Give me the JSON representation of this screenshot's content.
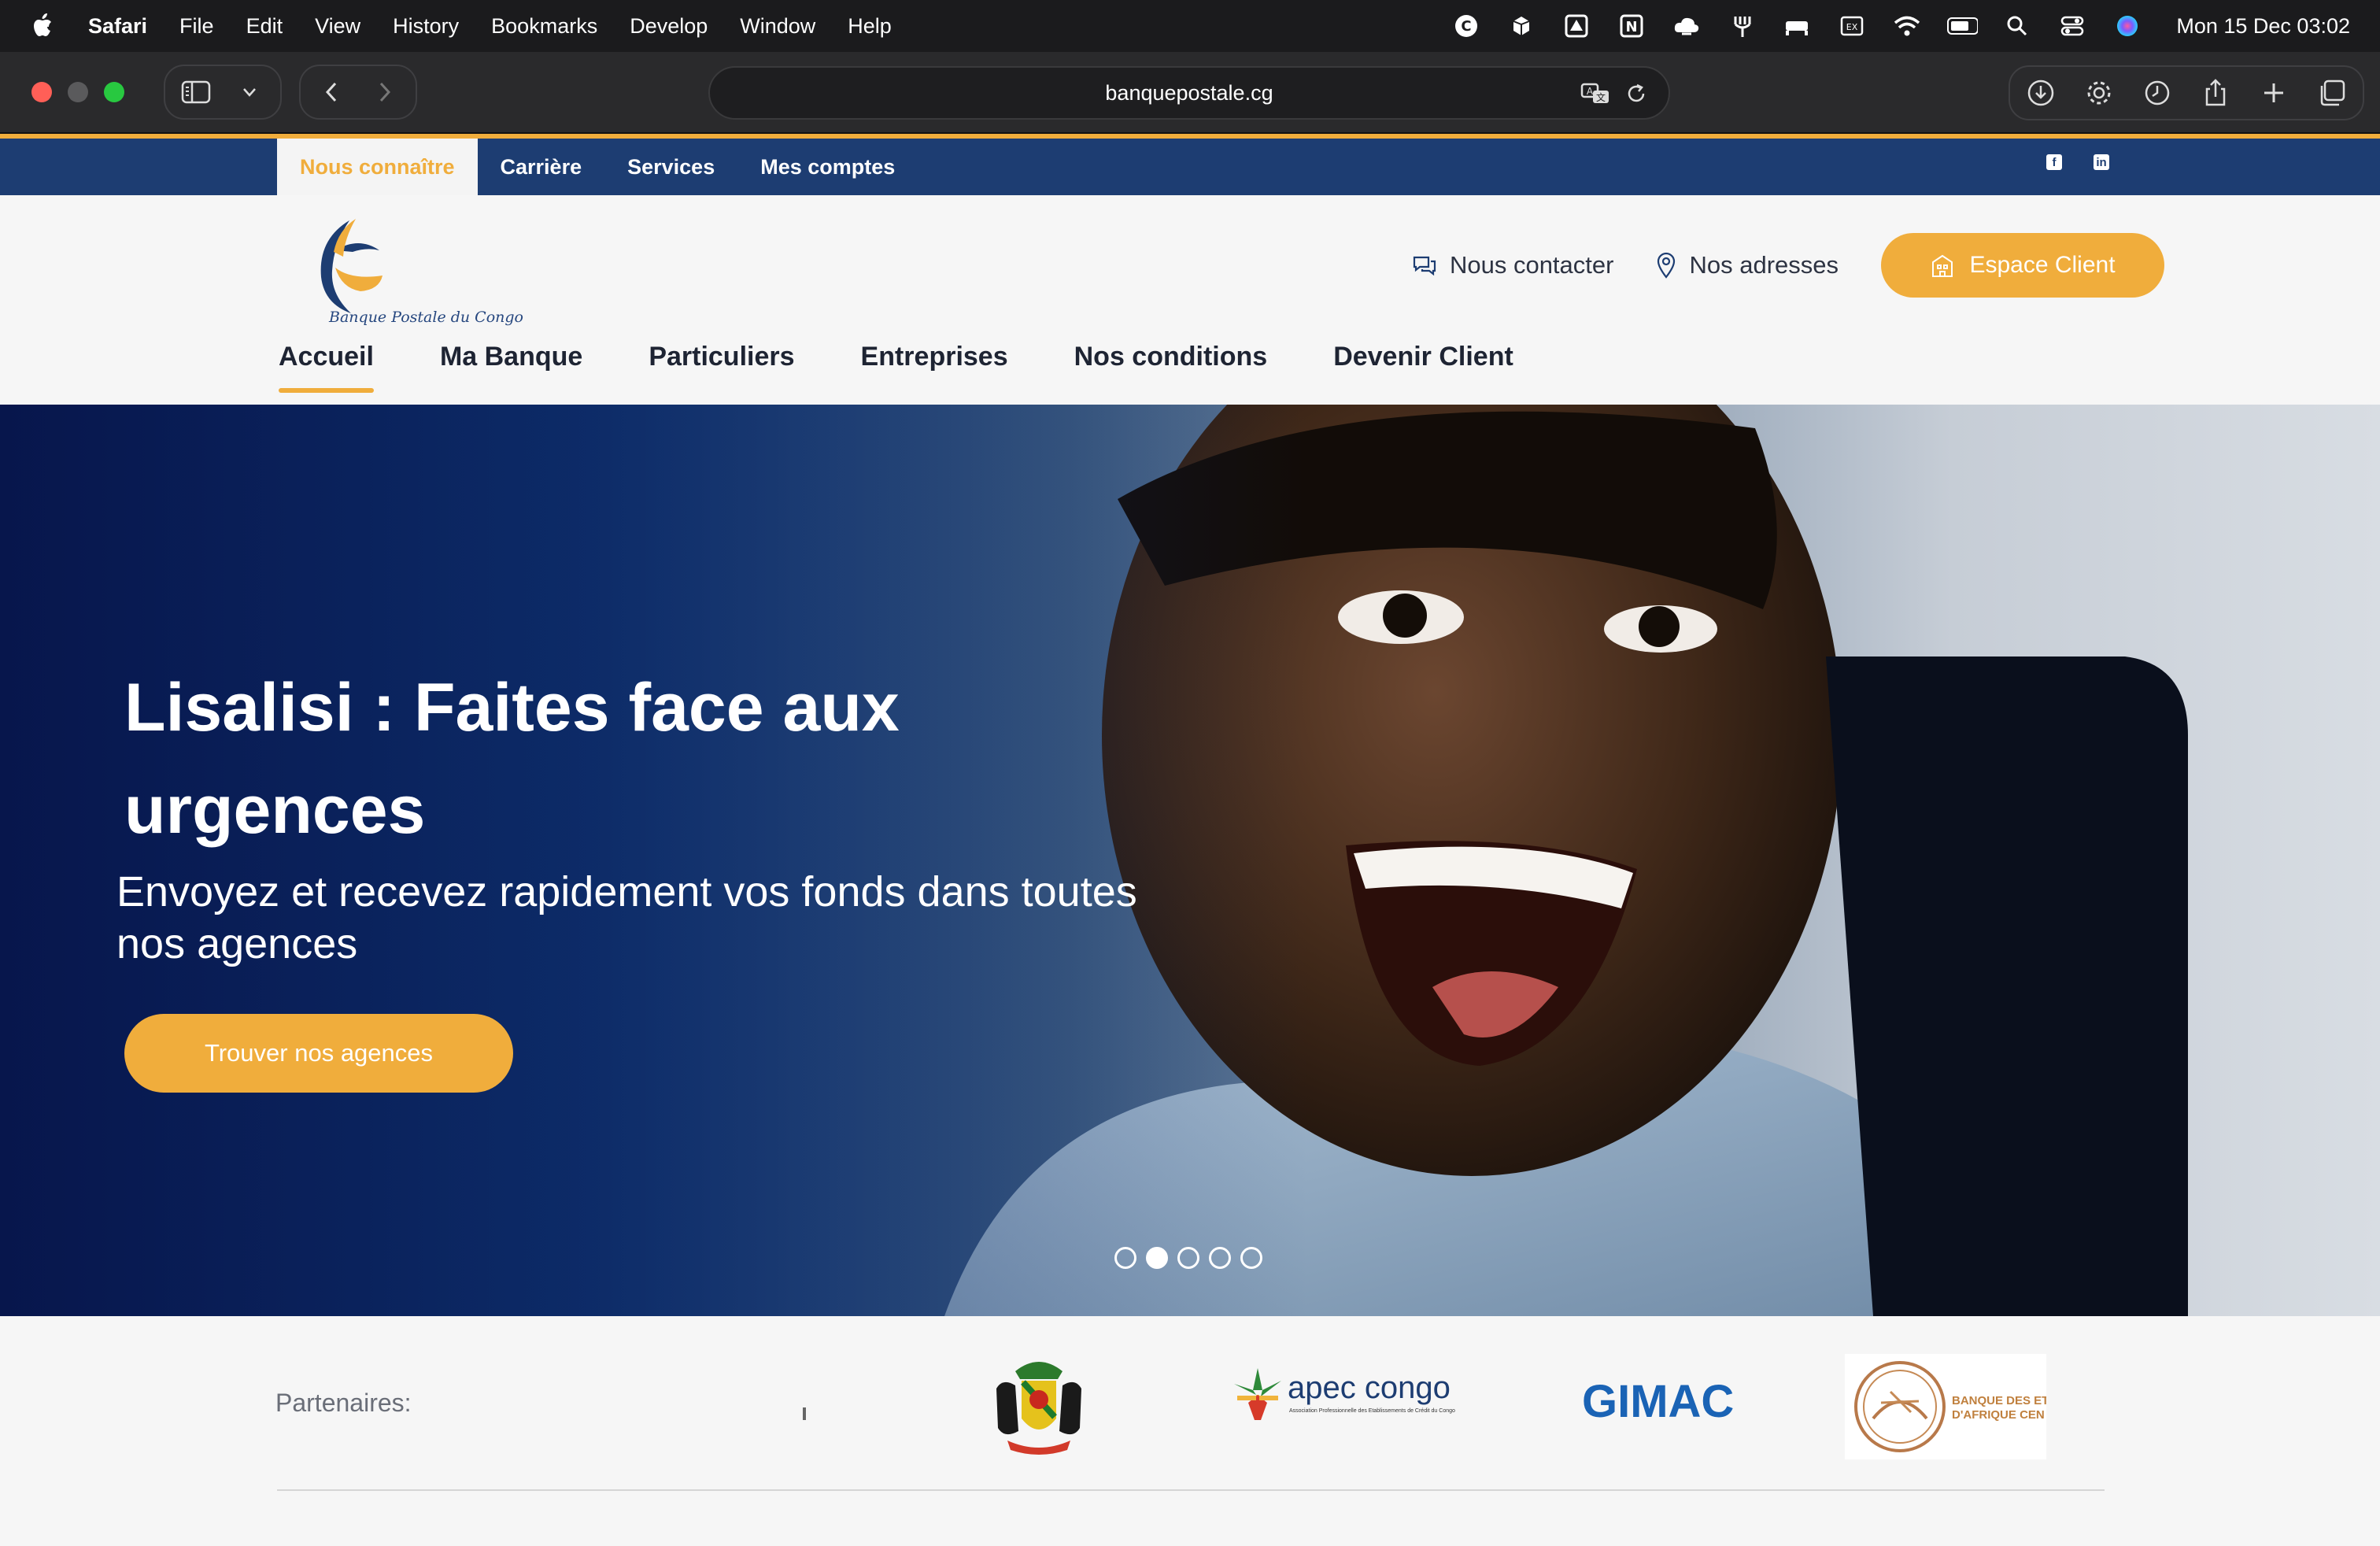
{
  "menubar": {
    "app_name": "Safari",
    "items": [
      "File",
      "Edit",
      "View",
      "History",
      "Bookmarks",
      "Develop",
      "Window",
      "Help"
    ],
    "clock": "Mon 15 Dec  03:02",
    "status_icons": [
      "c-circle-icon",
      "cube-icon",
      "drive-icon",
      "notion-icon",
      "cloud-icon",
      "fork-icon",
      "bed-icon",
      "ex-icon",
      "wifi-icon",
      "battery-icon",
      "search-icon",
      "control-center-icon",
      "siri-icon"
    ]
  },
  "browser": {
    "url": "banquepostale.cg"
  },
  "site": {
    "colors": {
      "navy": "#1d3d72",
      "accent": "#f0ad3c",
      "text_dark": "#1e2433"
    },
    "top_tabs": [
      "Nous connaître",
      "Carrière",
      "Services",
      "Mes comptes"
    ],
    "social": [
      "f",
      "in"
    ],
    "logo_tagline": "Banque Postale du Congo",
    "header_links": {
      "contact": "Nous contacter",
      "addresses": "Nos adresses",
      "espace_client": "Espace Client"
    },
    "main_nav": [
      "Accueil",
      "Ma Banque",
      "Particuliers",
      "Entreprises",
      "Nos conditions",
      "Devenir Client"
    ],
    "hero": {
      "title": "Lisalisi : Faites face aux urgences",
      "subtitle": "Envoyez et recevez rapidement vos fonds dans toutes nos agences",
      "cta": "Trouver nos agences",
      "slides": 5,
      "active_slide": 2
    },
    "partners": {
      "label": "Partenaires:",
      "logos": {
        "apec_name": "apec congo",
        "apec_sub": "Association Professionnelle des Etablissements de Crédit du Congo",
        "gimac": "GIMAC",
        "beac_line1": "BANQUE DES ET",
        "beac_line2": "D'AFRIQUE CEN"
      }
    }
  }
}
